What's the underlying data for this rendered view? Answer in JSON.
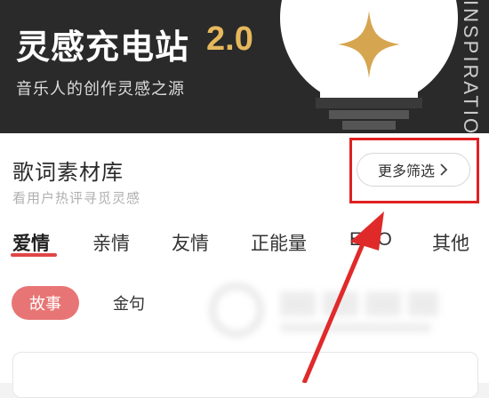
{
  "banner": {
    "title": "灵感充电站",
    "version": "2.0",
    "subtitle": "音乐人的创作灵感之源",
    "vertical_text": "INSPIRATIO"
  },
  "section": {
    "title": "歌词素材库",
    "subtitle": "看用户热评寻觅灵感",
    "filter_label": "更多筛选"
  },
  "tabs": [
    {
      "label": "爱情"
    },
    {
      "label": "亲情"
    },
    {
      "label": "友情"
    },
    {
      "label": "正能量"
    },
    {
      "label": "EMO"
    },
    {
      "label": "其他"
    }
  ],
  "subtabs": [
    {
      "label": "故事"
    },
    {
      "label": "金句"
    }
  ],
  "colors": {
    "banner_bg": "#2a2a2a",
    "accent_gold": "#e6b85c",
    "accent_red": "#e04646",
    "pill_active": "#e87575",
    "highlight_red": "#e02020"
  },
  "icons": [
    "lightbulb-illustration",
    "sparkle-icon",
    "chevron-right-icon",
    "annotation-arrow"
  ]
}
